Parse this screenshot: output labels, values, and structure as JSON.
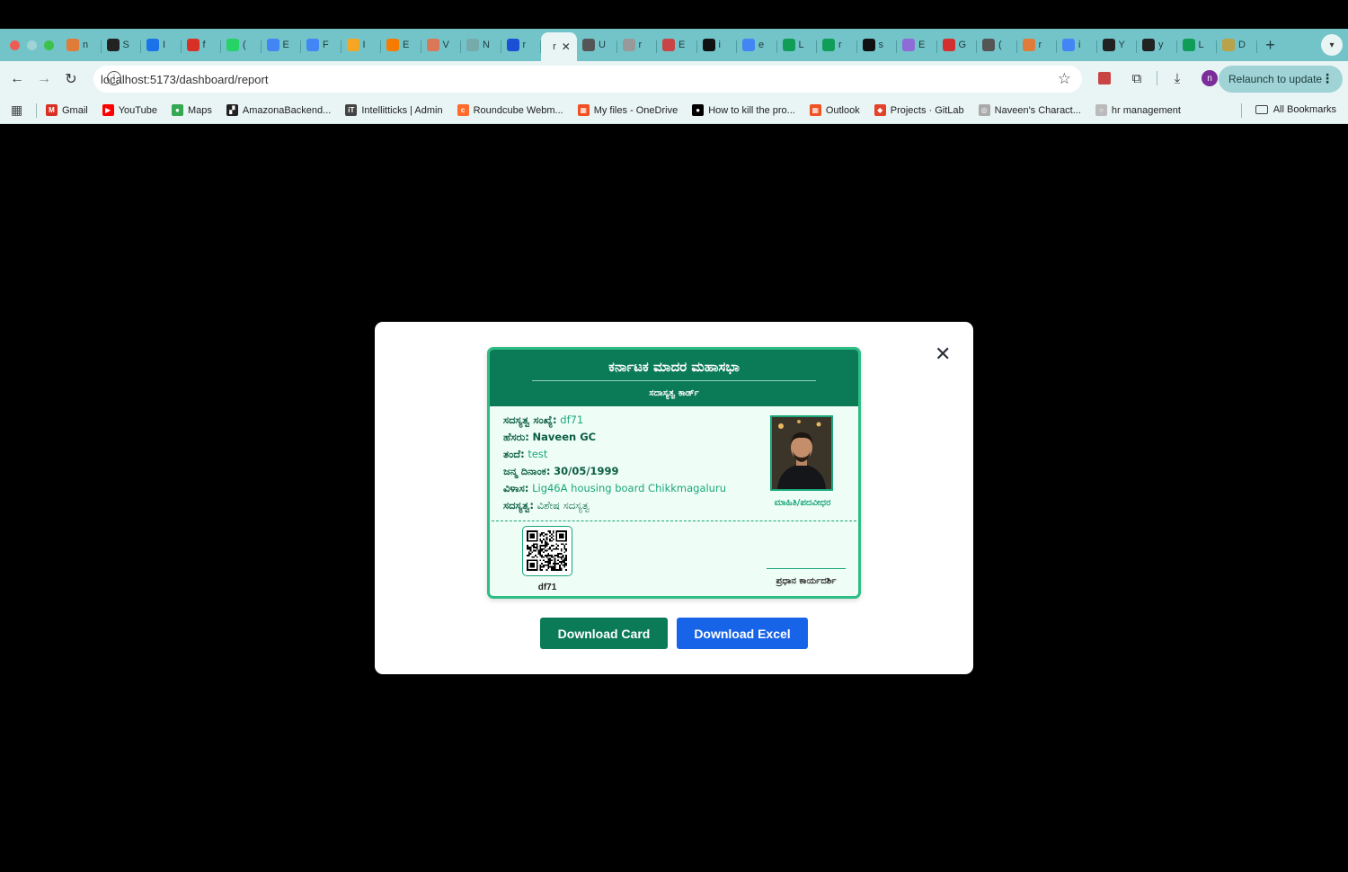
{
  "browser": {
    "tabs": [
      {
        "icon": "flask-icon",
        "letter": "n",
        "color": "#e07b39"
      },
      {
        "icon": "github-icon",
        "letter": "S",
        "color": "#222"
      },
      {
        "icon": "mail-icon",
        "letter": "I",
        "color": "#1a73e8"
      },
      {
        "icon": "gmail-icon",
        "letter": "f",
        "color": "#d93025"
      },
      {
        "icon": "whatsapp-icon",
        "letter": "(",
        "color": "#25d366"
      },
      {
        "icon": "docs-icon",
        "letter": "E",
        "color": "#4285f4"
      },
      {
        "icon": "docs-icon",
        "letter": "F",
        "color": "#4285f4"
      },
      {
        "icon": "postman-icon",
        "letter": "I",
        "color": "#f5a623"
      },
      {
        "icon": "postman-icon",
        "letter": "E",
        "color": "#f57c00"
      },
      {
        "icon": "claude-icon",
        "letter": "V",
        "color": "#d97757"
      },
      {
        "icon": "dash-icon",
        "letter": "N",
        "color": "#7aa"
      },
      {
        "icon": "vercel-icon",
        "letter": "r",
        "color": "#1a4fd6"
      },
      {
        "icon": "openai-icon",
        "letter": "U",
        "color": "#555"
      },
      {
        "icon": "drawing-icon",
        "letter": "r",
        "color": "#999"
      },
      {
        "icon": "pen-icon",
        "letter": "E",
        "color": "#c94444"
      },
      {
        "icon": "perplexity-icon",
        "letter": "i",
        "color": "#111"
      },
      {
        "icon": "google-icon",
        "letter": "e",
        "color": "#4285f4"
      },
      {
        "icon": "sheets-icon",
        "letter": "L",
        "color": "#0f9d58"
      },
      {
        "icon": "sheets-icon",
        "letter": "r",
        "color": "#0f9d58"
      },
      {
        "icon": "perplexity-icon",
        "letter": "s",
        "color": "#111"
      },
      {
        "icon": "gemini-icon",
        "letter": "E",
        "color": "#8e6bd6"
      },
      {
        "icon": "netlify-icon",
        "letter": "G",
        "color": "#d32f2f"
      },
      {
        "icon": "openai-icon",
        "letter": "(",
        "color": "#555"
      },
      {
        "icon": "flask-icon",
        "letter": "r",
        "color": "#e07b39"
      },
      {
        "icon": "google-icon",
        "letter": "i",
        "color": "#4285f4"
      },
      {
        "icon": "github-icon",
        "letter": "Y",
        "color": "#222"
      },
      {
        "icon": "github-icon",
        "letter": "y",
        "color": "#222"
      },
      {
        "icon": "sheets-icon",
        "letter": "L",
        "color": "#0f9d58"
      },
      {
        "icon": "emblem-icon",
        "letter": "D",
        "color": "#b8a24a"
      }
    ],
    "active_tab": {
      "letter": "r",
      "close": "✕"
    },
    "new_tab": "+",
    "url": "localhost:5173/dashboard/report",
    "avatar_letter": "n",
    "relaunch_label": "Relaunch to update",
    "bookmarks": [
      {
        "label": "Gmail",
        "icon": "gmail-icon",
        "color": "#d93025",
        "glyph": "M"
      },
      {
        "label": "YouTube",
        "icon": "youtube-icon",
        "color": "#ff0000",
        "glyph": "▶"
      },
      {
        "label": "Maps",
        "icon": "maps-icon",
        "color": "#34a853",
        "glyph": "●"
      },
      {
        "label": "AmazonaBackend...",
        "icon": "bookmark-icon",
        "color": "#222",
        "glyph": "▞"
      },
      {
        "label": "Intellitticks | Admin",
        "icon": "admin-icon",
        "color": "#444",
        "glyph": "iT"
      },
      {
        "label": "Roundcube Webm...",
        "icon": "cpanel-icon",
        "color": "#ff6c2c",
        "glyph": "c"
      },
      {
        "label": "My files - OneDrive",
        "icon": "microsoft-icon",
        "color": "#f25022",
        "glyph": "▦"
      },
      {
        "label": "How to kill the pro...",
        "icon": "medium-icon",
        "color": "#000",
        "glyph": "●"
      },
      {
        "label": "Outlook",
        "icon": "microsoft-icon",
        "color": "#f25022",
        "glyph": "▦"
      },
      {
        "label": "Projects · GitLab",
        "icon": "gitlab-icon",
        "color": "#e24329",
        "glyph": "◆"
      },
      {
        "label": "Naveen's Charact...",
        "icon": "openai-icon",
        "color": "#aaa",
        "glyph": "◎"
      },
      {
        "label": "hr management",
        "icon": "github-icon",
        "color": "#bbb",
        "glyph": "○"
      }
    ],
    "all_bookmarks": "All Bookmarks"
  },
  "modal": {
    "close": "✕",
    "card": {
      "title": "ಕರ್ನಾಟಕ ಮಾದರ ಮಹಾಸಭಾ",
      "subtitle": "ಸದಾಸ್ಯತ್ವ ಕಾರ್ಡ್",
      "fields": {
        "membership_no_label": "ಸದಸ್ಯತ್ವ ಸಂಖ್ಯೆ:",
        "membership_no": "df71",
        "name_label": "ಹೆಸರು:",
        "name": "Naveen GC",
        "father_label": "ತಂದೆ:",
        "father": "test",
        "dob_label": "ಜನ್ಮ ದಿನಾಂಕ:",
        "dob": "30/05/1999",
        "address_label": "ವಿಳಾಸ:",
        "address": "Lig46A housing board Chikkmagaluru",
        "membership_label": "ಸದಸ್ಯತ್ವ:",
        "membership": "ವಿಶೇಷ ಸದಸ್ಯತ್ವ"
      },
      "photo_caption": "ಮಾಹಿತಿ/ಪದವೀಧರ",
      "qr_code": "df71",
      "signature_label": "ಪ್ರಧಾನ ಕಾರ್ಯದರ್ಶಿ"
    },
    "buttons": {
      "download_card": "Download Card",
      "download_excel": "Download Excel"
    },
    "colors": {
      "card_header": "#0a7a57",
      "card_border": "#2ebd85",
      "excel_button": "#1764e8"
    }
  }
}
